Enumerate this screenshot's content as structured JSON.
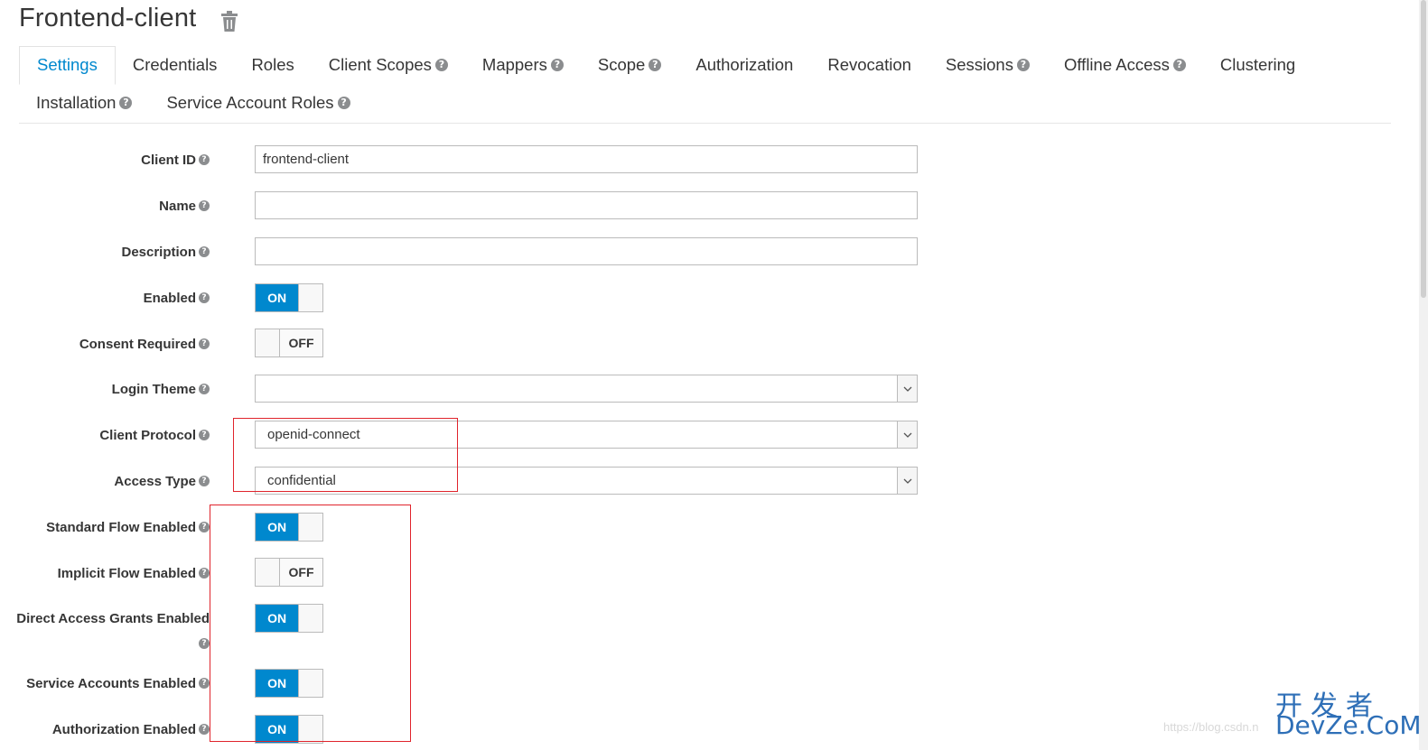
{
  "header": {
    "title": "Frontend-client",
    "delete_icon": "trash-icon"
  },
  "tabs": [
    {
      "label": "Settings",
      "help": false,
      "active": true
    },
    {
      "label": "Credentials",
      "help": false
    },
    {
      "label": "Roles",
      "help": false
    },
    {
      "label": "Client Scopes",
      "help": true
    },
    {
      "label": "Mappers",
      "help": true
    },
    {
      "label": "Scope",
      "help": true
    },
    {
      "label": "Authorization",
      "help": false
    },
    {
      "label": "Revocation",
      "help": false
    },
    {
      "label": "Sessions",
      "help": true
    },
    {
      "label": "Offline Access",
      "help": true
    },
    {
      "label": "Clustering",
      "help": false
    },
    {
      "label": "Installation",
      "help": true
    },
    {
      "label": "Service Account Roles",
      "help": true
    }
  ],
  "help_glyph": "?",
  "form": {
    "client_id": {
      "label": "Client ID",
      "value": "frontend-client"
    },
    "name": {
      "label": "Name",
      "value": ""
    },
    "description": {
      "label": "Description",
      "value": ""
    },
    "enabled": {
      "label": "Enabled",
      "state": "ON"
    },
    "consent_required": {
      "label": "Consent Required",
      "state": "OFF"
    },
    "login_theme": {
      "label": "Login Theme",
      "value": ""
    },
    "client_protocol": {
      "label": "Client Protocol",
      "value": "openid-connect"
    },
    "access_type": {
      "label": "Access Type",
      "value": "confidential"
    },
    "standard_flow": {
      "label": "Standard Flow Enabled",
      "state": "ON"
    },
    "implicit_flow": {
      "label": "Implicit Flow Enabled",
      "state": "OFF"
    },
    "direct_access": {
      "label": "Direct Access Grants Enabled",
      "state": "ON"
    },
    "service_accounts": {
      "label": "Service Accounts Enabled",
      "state": "ON"
    },
    "authorization": {
      "label": "Authorization Enabled",
      "state": "ON"
    }
  },
  "watermark": {
    "cn": "开发者",
    "en": "DevZe.CoM",
    "url": "https://blog.csdn.n"
  },
  "colors": {
    "accent": "#0088ce",
    "highlight": "#e0242c",
    "text": "#363636"
  }
}
